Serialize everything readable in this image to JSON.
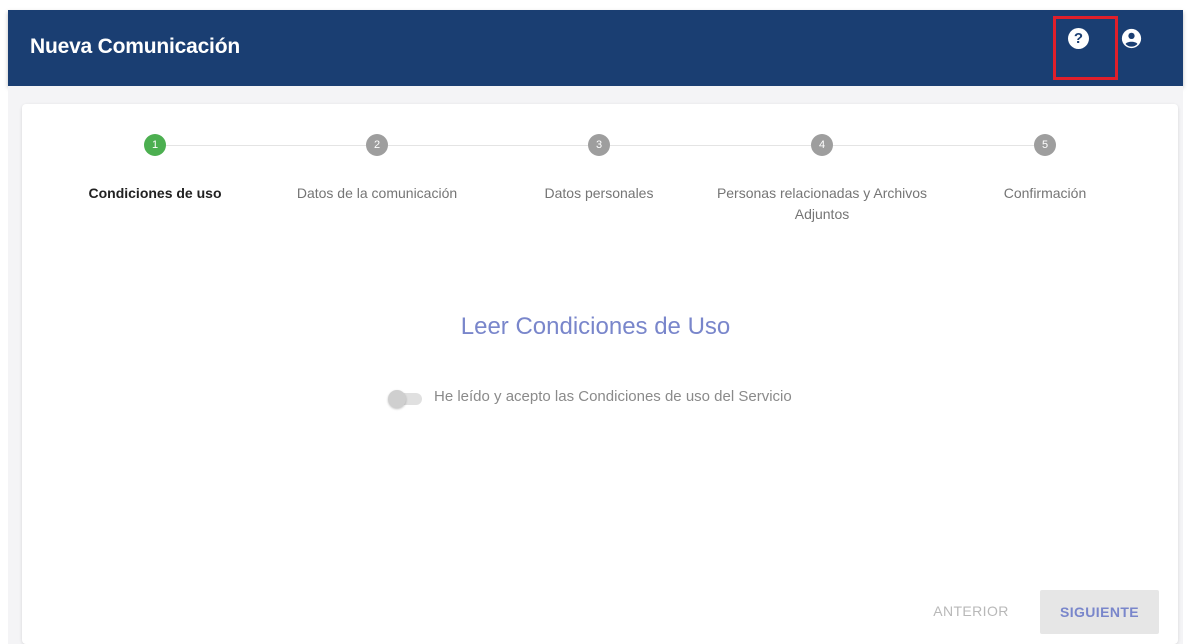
{
  "header": {
    "title": "Nueva Comunicación",
    "help_icon": "help-circle-icon",
    "help_glyph": "?",
    "account_icon": "account-circle-icon",
    "highlight_color": "#e01f2b",
    "background_color": "#1a3e72"
  },
  "stepper": {
    "active_color": "#4caf50",
    "inactive_color": "#9e9e9e",
    "steps": [
      {
        "number": "1",
        "label": "Condiciones de uso",
        "active": true
      },
      {
        "number": "2",
        "label": "Datos de la comunicación",
        "active": false
      },
      {
        "number": "3",
        "label": "Datos personales",
        "active": false
      },
      {
        "number": "4",
        "label": "Personas relacionadas y Archivos Adjuntos",
        "active": false
      },
      {
        "number": "5",
        "label": "Confirmación",
        "active": false
      }
    ]
  },
  "main": {
    "section_title": "Leer Condiciones de Uso",
    "accept_toggle_label": "He leído y acepto las Condiciones de uso del Servicio",
    "accept_toggle_checked": false
  },
  "footer": {
    "previous_label": "ANTERIOR",
    "next_label": "SIGUIENTE"
  }
}
